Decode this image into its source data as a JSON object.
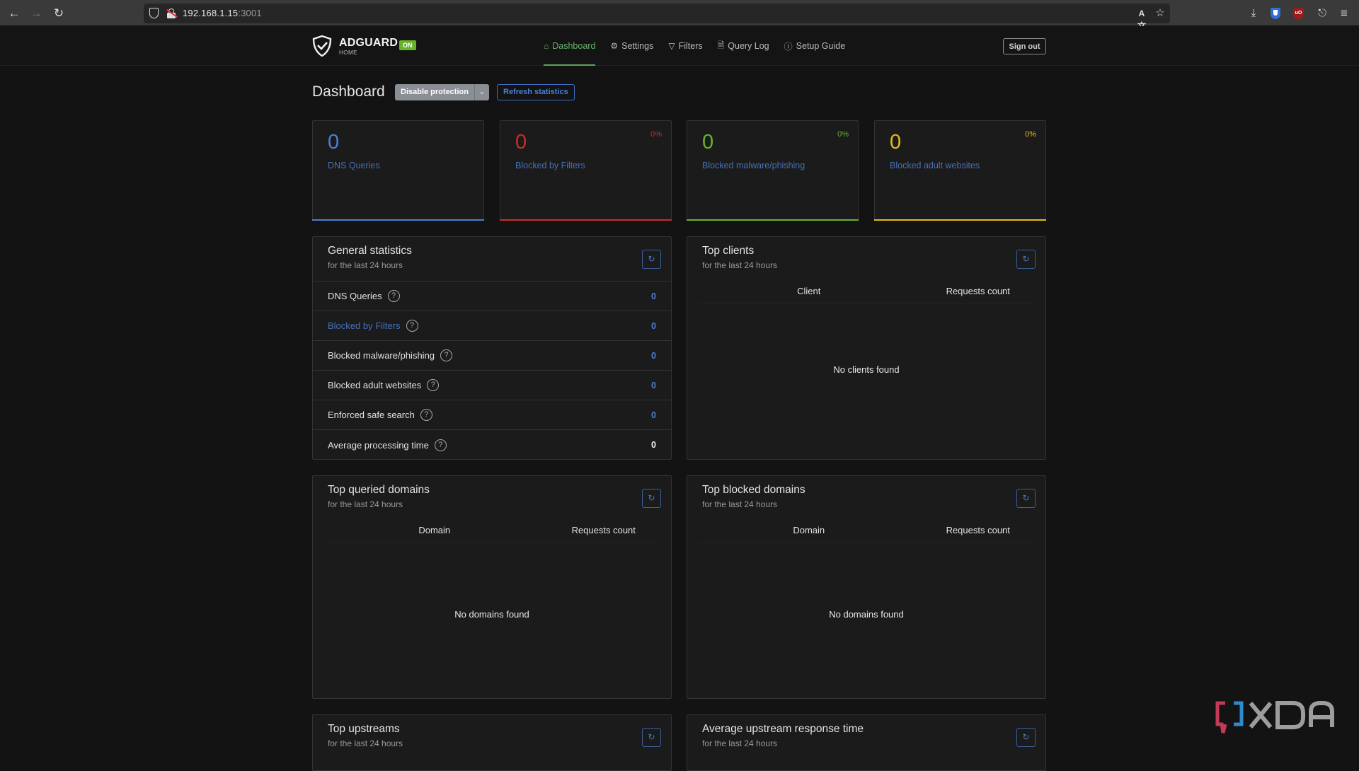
{
  "browser": {
    "url_host": "192.168.1.15",
    "url_port": ":3001",
    "icons": [
      "back-icon",
      "forward-icon",
      "reload-icon",
      "tracking-shield-icon",
      "insecure-lock-icon",
      "translate-icon",
      "bookmark-star-icon",
      "download-icon",
      "bitwarden-icon",
      "ublock-icon",
      "extensions-icon",
      "menu-icon"
    ]
  },
  "header": {
    "logo_name": "ADGUARD",
    "logo_sub": "HOME",
    "status_badge": "ON",
    "nav": [
      {
        "label": "Dashboard",
        "icon": "home-icon",
        "active": true
      },
      {
        "label": "Settings",
        "icon": "gear-icon",
        "active": false
      },
      {
        "label": "Filters",
        "icon": "filter-icon",
        "active": false
      },
      {
        "label": "Query Log",
        "icon": "document-icon",
        "active": false
      },
      {
        "label": "Setup Guide",
        "icon": "help-circle-icon",
        "active": false
      }
    ],
    "sign_out": "Sign out"
  },
  "page": {
    "title": "Dashboard",
    "disable_protection": "Disable protection",
    "refresh_statistics": "Refresh statistics"
  },
  "colors": {
    "blue": "#4b7fd6",
    "red": "#cd2b2b",
    "green": "#67b32a",
    "yellow": "#e8b91c"
  },
  "stat_cards": [
    {
      "value": "0",
      "label": "DNS Queries",
      "percent": ""
    },
    {
      "value": "0",
      "label": "Blocked by Filters",
      "percent": "0%"
    },
    {
      "value": "0",
      "label": "Blocked malware/phishing",
      "percent": "0%"
    },
    {
      "value": "0",
      "label": "Blocked adult websites",
      "percent": "0%"
    }
  ],
  "general_statistics": {
    "title": "General statistics",
    "subtitle": "for the last 24 hours",
    "rows": [
      {
        "label": "DNS Queries",
        "value": "0"
      },
      {
        "label": "Blocked by Filters",
        "value": "0"
      },
      {
        "label": "Blocked malware/phishing",
        "value": "0"
      },
      {
        "label": "Blocked adult websites",
        "value": "0"
      },
      {
        "label": "Enforced safe search",
        "value": "0"
      },
      {
        "label": "Average processing time",
        "value": "0"
      }
    ]
  },
  "top_clients": {
    "title": "Top clients",
    "subtitle": "for the last 24 hours",
    "columns": [
      "Client",
      "Requests count"
    ],
    "empty": "No clients found"
  },
  "top_queried": {
    "title": "Top queried domains",
    "subtitle": "for the last 24 hours",
    "columns": [
      "Domain",
      "Requests count"
    ],
    "empty": "No domains found"
  },
  "top_blocked": {
    "title": "Top blocked domains",
    "subtitle": "for the last 24 hours",
    "columns": [
      "Domain",
      "Requests count"
    ],
    "empty": "No domains found"
  },
  "top_upstreams": {
    "title": "Top upstreams",
    "subtitle": "for the last 24 hours"
  },
  "avg_upstream": {
    "title": "Average upstream response time",
    "subtitle": "for the last 24 hours"
  },
  "watermark": "XDA"
}
